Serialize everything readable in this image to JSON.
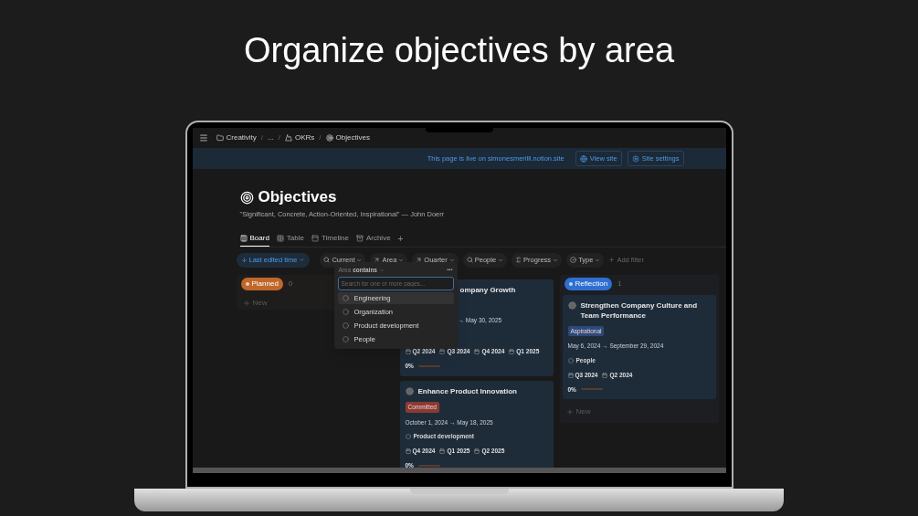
{
  "headline": "Organize objectives by area",
  "breadcrumb": [
    {
      "text": "Creativity",
      "kind": "folder"
    },
    {
      "text": "...",
      "kind": "plain"
    },
    {
      "text": "OKRs",
      "kind": "mountain"
    },
    {
      "text": "Objectives",
      "kind": "target"
    }
  ],
  "breadcrumb_separator": "/",
  "banner": {
    "message": "This page is live on simonesmerilli.notion.site",
    "buttons": [
      {
        "label": "View site",
        "kind": "globe"
      },
      {
        "label": "Site settings",
        "kind": "settings"
      }
    ]
  },
  "page": {
    "title": "Objectives",
    "quote": "\"Significant, Concrete, Action-Oriented, Inspirational\" — John Doerr"
  },
  "views": [
    {
      "label": "Board",
      "kind": "board",
      "selected": true
    },
    {
      "label": "Table",
      "kind": "table",
      "selected": false
    },
    {
      "label": "Timeline",
      "kind": "timeline",
      "selected": false
    },
    {
      "label": "Archive",
      "kind": "archive",
      "selected": false
    }
  ],
  "add_view": "+",
  "sort": "Last edited time",
  "filters": [
    {
      "label": "Current",
      "kind": "search"
    },
    {
      "label": "Area",
      "kind": "relation"
    },
    {
      "label": "Quarter",
      "kind": "relation"
    },
    {
      "label": "People",
      "kind": "search"
    },
    {
      "label": "Progress",
      "kind": "sum"
    },
    {
      "label": "Type",
      "kind": "select"
    }
  ],
  "add_filter": "Add filter",
  "dropdown": {
    "property": "Area",
    "operator": "contains",
    "more": "•••",
    "placeholder": "Search for one or more pages...",
    "options": [
      {
        "label": "Engineering",
        "selected": true
      },
      {
        "label": "Organization",
        "selected": false
      },
      {
        "label": "Product development",
        "selected": false
      },
      {
        "label": "People",
        "selected": false
      }
    ]
  },
  "columns": [
    {
      "name": "Planned",
      "color": "#c0672a",
      "count": "0",
      "new_label": "New"
    },
    {
      "cards": [
        {
          "title": "ompany Growth",
          "dates": "→ May 30, 2025",
          "quarters": [
            "Q2 2024",
            "Q3 2024",
            "Q4 2024",
            "Q1 2025"
          ],
          "progress": "0%",
          "level": 0
        },
        {
          "title": "Enhance Product Innovation",
          "status": {
            "label": "Committed",
            "color": "#8b3a33"
          },
          "dates": "October 1, 2024 → May 18, 2025",
          "area": "Product development",
          "quarters": [
            "Q4 2024",
            "Q1 2025",
            "Q2 2025"
          ],
          "progress": "0%",
          "level": 0
        }
      ]
    },
    {
      "name": "Reflection",
      "color": "#2f6fd1",
      "count": "1",
      "new_label": "New",
      "cards": [
        {
          "title": "Strengthen Company Culture and Team Performance",
          "status": {
            "label": "Aspirational",
            "color": "#2b4a7a"
          },
          "dates": "May 6, 2024 → September 29, 2024",
          "area": "People",
          "quarters": [
            "Q3 2024",
            "Q2 2024"
          ],
          "progress": "0%",
          "level": 0
        }
      ]
    }
  ]
}
